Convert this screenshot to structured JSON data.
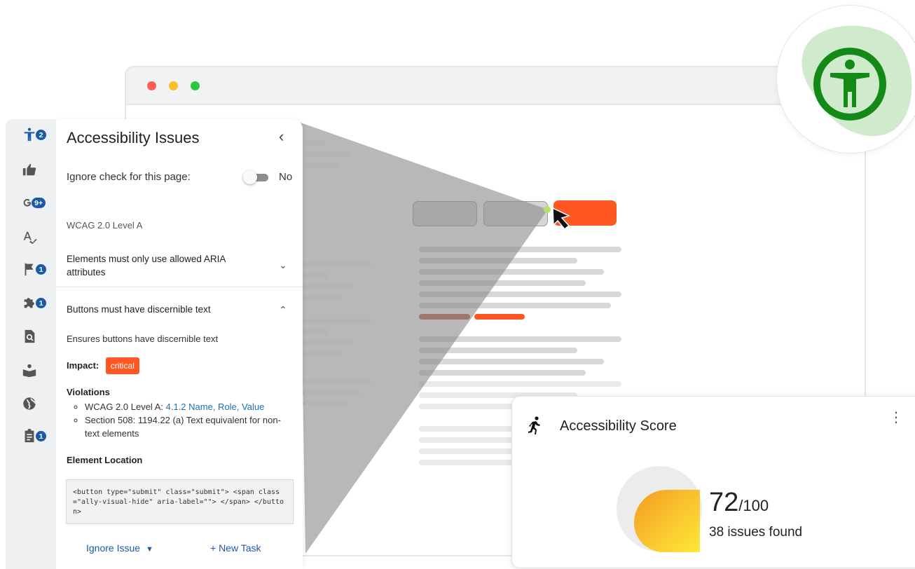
{
  "panel": {
    "title": "Accessibility Issues",
    "back_icon": "chevron-left",
    "ignore_label": "Ignore check for this page:",
    "ignore_value": "No",
    "wcag_level": "WCAG 2.0 Level A",
    "rule_collapsed": "Elements must only use allowed ARIA attributes",
    "rule_expanded": "Buttons must have discernible text",
    "description": "Ensures buttons have discernible text",
    "impact_label": "Impact:",
    "impact_value": "critical",
    "violations_heading": "Violations",
    "violation_1_prefix": "WCAG 2.0 Level A:",
    "violation_1_link": "4.1.2 Name, Role, Value",
    "violation_2": "Section 508: 1194.22 (a) Text equivalent for non-text elements",
    "element_location_heading": "Element Location",
    "code": "<button type=\"submit\" class=\"submit\"> <span class=\"ally-visual-hide\" aria-label=\"\"> </span> </button>",
    "ignore_issue": "Ignore Issue",
    "new_task": "+ New Task"
  },
  "rail": {
    "items": [
      {
        "icon": "accessibility-icon",
        "badge": "2"
      },
      {
        "icon": "thumbs-up-icon",
        "badge": ""
      },
      {
        "icon": "google-icon",
        "badge": "9+"
      },
      {
        "icon": "spellcheck-icon",
        "badge": ""
      },
      {
        "icon": "flag-icon",
        "badge": "1"
      },
      {
        "icon": "puzzle-icon",
        "badge": "1"
      },
      {
        "icon": "file-search-icon",
        "badge": ""
      },
      {
        "icon": "reader-icon",
        "badge": ""
      },
      {
        "icon": "globe-icon",
        "badge": ""
      },
      {
        "icon": "clipboard-icon",
        "badge": "1"
      }
    ]
  },
  "score": {
    "title": "Accessibility Score",
    "value": "72",
    "max": "/100",
    "issues": "38 issues found"
  },
  "colors": {
    "accent_blue": "#1a5aa6",
    "critical": "#ff5722",
    "a11y_green": "#138a17"
  }
}
